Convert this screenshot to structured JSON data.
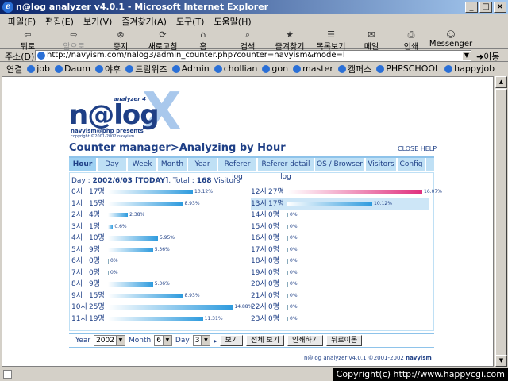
{
  "window": {
    "title": "n@log analyzer v4.0.1 - Microsoft Internet Explorer",
    "buttons": [
      "_",
      "□",
      "×"
    ]
  },
  "menu": [
    "파일(F)",
    "편집(E)",
    "보기(V)",
    "즐겨찾기(A)",
    "도구(T)",
    "도움말(H)"
  ],
  "toolbar": [
    {
      "label": "뒤로",
      "icon": "back-arrow-icon",
      "glyph": "⇦",
      "disabled": false
    },
    {
      "label": "앞으로",
      "icon": "forward-arrow-icon",
      "glyph": "⇨",
      "disabled": true
    },
    {
      "label": "중지",
      "icon": "stop-icon",
      "glyph": "⊗",
      "disabled": false
    },
    {
      "label": "새로고침",
      "icon": "refresh-icon",
      "glyph": "⟳",
      "disabled": false
    },
    {
      "label": "홈",
      "icon": "home-icon",
      "glyph": "⌂",
      "disabled": false
    },
    {
      "label": "검색",
      "icon": "search-icon",
      "glyph": "⌕",
      "disabled": false
    },
    {
      "label": "즐겨찾기",
      "icon": "favorites-icon",
      "glyph": "★",
      "disabled": false
    },
    {
      "label": "목록보기",
      "icon": "history-icon",
      "glyph": "☰",
      "disabled": false
    },
    {
      "label": "메일",
      "icon": "mail-icon",
      "glyph": "✉",
      "disabled": false
    },
    {
      "label": "인쇄",
      "icon": "print-icon",
      "glyph": "⎙",
      "disabled": false
    },
    {
      "label": "Messenger",
      "icon": "messenger-icon",
      "glyph": "☺",
      "disabled": false
    }
  ],
  "address": {
    "label": "주소(D)",
    "url": "http://navyism.com/nalog3/admin_counter.php?counter=navyism&mode=l",
    "go_label": "이동"
  },
  "links": {
    "label": "연결",
    "items": [
      "job",
      "Daum",
      "야후",
      "드림위즈",
      "Admin",
      "chollian",
      "gon",
      "master",
      "캠퍼스",
      "PHPSCHOOL",
      "happyjob"
    ]
  },
  "logo": {
    "word": "n@log",
    "letter": "X",
    "subtitle": "analyzer 4",
    "presents": "navyism@php presents",
    "copyright": "copyright ©2001-2002 navyism"
  },
  "page": {
    "title": "Counter manager>Analyzing by Hour",
    "close_help": "CLOSE HELP"
  },
  "tabs": [
    {
      "label": "Hour",
      "active": true
    },
    {
      "label": "Day",
      "active": false
    },
    {
      "label": "Week",
      "active": false
    },
    {
      "label": "Month",
      "active": false
    },
    {
      "label": "Year",
      "active": false
    },
    {
      "label": "Referer log",
      "active": false
    },
    {
      "label": "Referer detail log",
      "active": false
    },
    {
      "label": "OS / Browser",
      "active": false
    },
    {
      "label": "Visitors",
      "active": false
    },
    {
      "label": "Config",
      "active": false
    }
  ],
  "summary": {
    "day_label": "Day : ",
    "date": "2002/6/03 [TODAY]",
    "total_label": ", Total : ",
    "total": "168",
    "visitors_label": "Visitors"
  },
  "chart_data": {
    "type": "bar",
    "categories": [
      "0시",
      "1시",
      "2시",
      "3시",
      "4시",
      "5시",
      "6시",
      "7시",
      "8시",
      "9시",
      "10시",
      "11시",
      "12시",
      "13시",
      "14시",
      "15시",
      "16시",
      "17시",
      "18시",
      "19시",
      "20시",
      "21시",
      "22시",
      "23시"
    ],
    "count_labels": [
      "17명",
      "15명",
      "4명",
      "1명",
      "10명",
      "9명",
      "0명",
      "0명",
      "9명",
      "15명",
      "25명",
      "19명",
      "27명",
      "17명",
      "0명",
      "0명",
      "0명",
      "0명",
      "0명",
      "0명",
      "0명",
      "0명",
      "0명",
      "0명"
    ],
    "values": [
      17,
      15,
      4,
      1,
      10,
      9,
      0,
      0,
      9,
      15,
      25,
      19,
      27,
      17,
      0,
      0,
      0,
      0,
      0,
      0,
      0,
      0,
      0,
      0
    ],
    "percent_labels": [
      "10.12%",
      "8.93%",
      "2.38%",
      "0.6%",
      "5.95%",
      "5.36%",
      "0%",
      "0%",
      "5.36%",
      "8.93%",
      "14.88%",
      "11.31%",
      "16.07%",
      "10.12%",
      "0%",
      "0%",
      "0%",
      "0%",
      "0%",
      "0%",
      "0%",
      "0%",
      "0%",
      "0%"
    ],
    "percents": [
      10.12,
      8.93,
      2.38,
      0.6,
      5.95,
      5.36,
      0,
      0,
      5.36,
      8.93,
      14.88,
      11.31,
      16.07,
      10.12,
      0,
      0,
      0,
      0,
      0,
      0,
      0,
      0,
      0,
      0
    ],
    "max_index": 12,
    "highlight_index": 13,
    "colors": {
      "bar": "#2e9bde",
      "max": "#e0307e",
      "text": "#1e3f86"
    }
  },
  "controls": {
    "year_label": "Year",
    "year_value": "2002",
    "month_label": "Month",
    "month_value": "6",
    "day_label": "Day",
    "day_value": "3",
    "view_button": "보기",
    "all_view_button": "전체 보기",
    "print_button": "인쇄하기",
    "back_button": "뒤로이동"
  },
  "footer": {
    "text": "n@log analyzer v4.0.1 ©2001-2002",
    "author": "navyism"
  },
  "watermark": "Copyright(c) http://www.happycgi.com"
}
